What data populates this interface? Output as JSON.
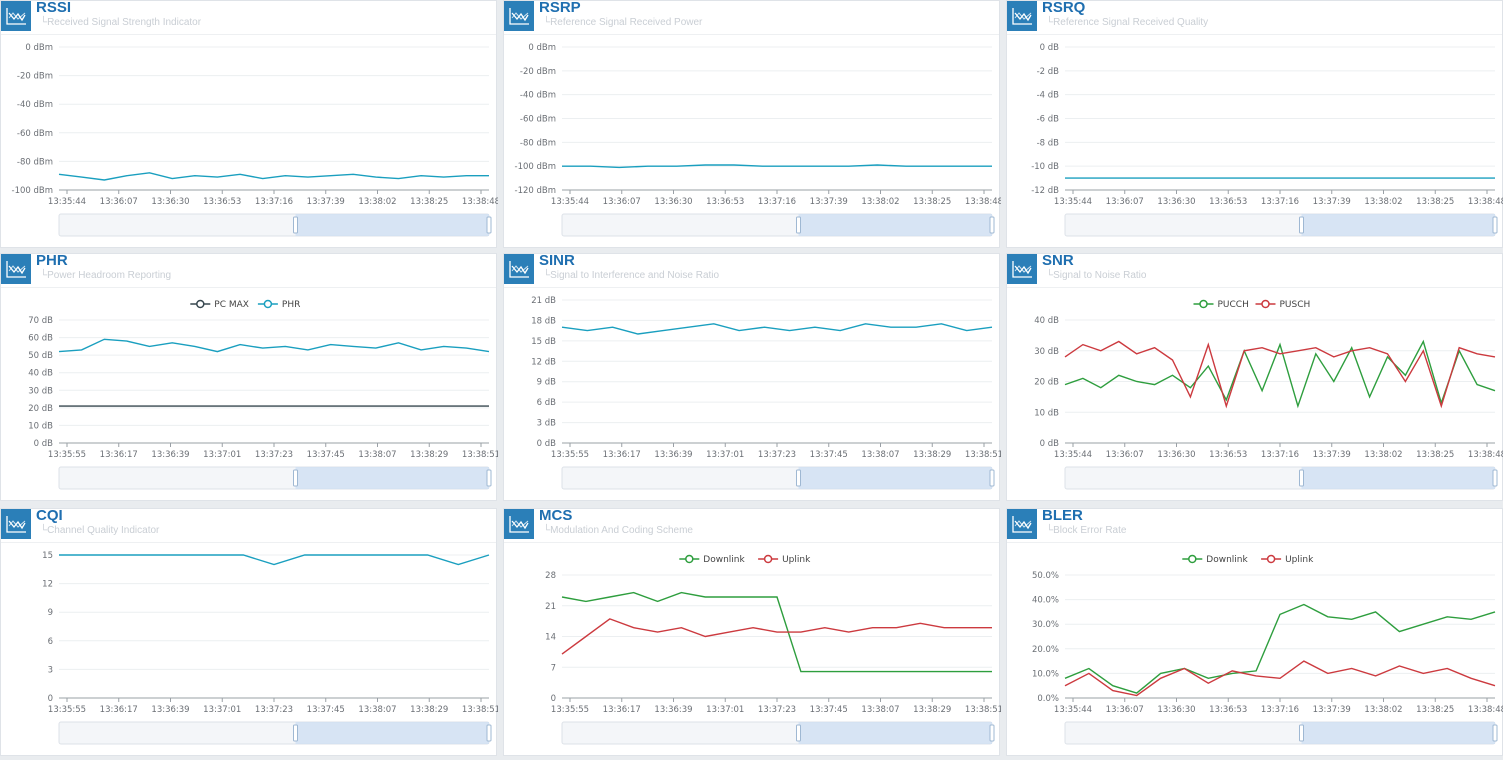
{
  "panels": [
    {
      "id": "rssi",
      "title": "RSSI",
      "subtitle": "└Received Signal Strength Indicator"
    },
    {
      "id": "rsrp",
      "title": "RSRP",
      "subtitle": "└Reference Signal Received Power"
    },
    {
      "id": "rsrq",
      "title": "RSRQ",
      "subtitle": "└Reference Signal Received Quality"
    },
    {
      "id": "phr",
      "title": "PHR",
      "subtitle": "└Power Headroom Reporting"
    },
    {
      "id": "sinr",
      "title": "SINR",
      "subtitle": "└Signal to Interference and Noise Ratio"
    },
    {
      "id": "snr",
      "title": "SNR",
      "subtitle": "└Signal to Noise Ratio"
    },
    {
      "id": "cqi",
      "title": "CQI",
      "subtitle": "└Channel Quality Indicator"
    },
    {
      "id": "mcs",
      "title": "MCS",
      "subtitle": "└Modulation And Coding Scheme"
    },
    {
      "id": "bler",
      "title": "BLER",
      "subtitle": "└Block Error Rate"
    }
  ],
  "chart_data": [
    {
      "id": "rssi",
      "type": "line",
      "yticks": [
        "0 dBm",
        "-20 dBm",
        "-40 dBm",
        "-60 dBm",
        "-80 dBm",
        "-100 dBm"
      ],
      "ylim": [
        -100,
        0
      ],
      "x": [
        "13:35:44",
        "13:36:07",
        "13:36:30",
        "13:36:53",
        "13:37:16",
        "13:37:39",
        "13:38:02",
        "13:38:25",
        "13:38:48"
      ],
      "series": [
        {
          "color": "#1a9fbf",
          "y": [
            -89,
            -91,
            -93,
            -90,
            -88,
            -92,
            -90,
            -91,
            -89,
            -92,
            -90,
            -91,
            -90,
            -89,
            -91,
            -92,
            -90,
            -91,
            -90,
            -90
          ]
        }
      ]
    },
    {
      "id": "rsrp",
      "type": "line",
      "yticks": [
        "0 dBm",
        "-20 dBm",
        "-40 dBm",
        "-60 dBm",
        "-80 dBm",
        "-100 dBm",
        "-120 dBm"
      ],
      "ylim": [
        -120,
        0
      ],
      "x": [
        "13:35:44",
        "13:36:07",
        "13:36:30",
        "13:36:53",
        "13:37:16",
        "13:37:39",
        "13:38:02",
        "13:38:25",
        "13:38:48"
      ],
      "series": [
        {
          "color": "#1a9fbf",
          "y": [
            -100,
            -100,
            -101,
            -100,
            -100,
            -99,
            -99,
            -100,
            -100,
            -100,
            -100,
            -99,
            -100,
            -100,
            -100,
            -100
          ]
        }
      ]
    },
    {
      "id": "rsrq",
      "type": "line",
      "yticks": [
        "0 dB",
        "-2 dB",
        "-4 dB",
        "-6 dB",
        "-8 dB",
        "-10 dB",
        "-12 dB"
      ],
      "ylim": [
        -12,
        0
      ],
      "x": [
        "13:35:44",
        "13:36:07",
        "13:36:30",
        "13:36:53",
        "13:37:16",
        "13:37:39",
        "13:38:02",
        "13:38:25",
        "13:38:48"
      ],
      "series": [
        {
          "color": "#1a9fbf",
          "y": [
            -11,
            -11,
            -11,
            -11,
            -11,
            -11,
            -11,
            -11
          ]
        }
      ]
    },
    {
      "id": "phr",
      "type": "line",
      "yticks": [
        "70 dB",
        "60 dB",
        "50 dB",
        "40 dB",
        "30 dB",
        "20 dB",
        "10 dB",
        "0 dB"
      ],
      "ylim": [
        0,
        70
      ],
      "x": [
        "13:35:55",
        "13:36:17",
        "13:36:39",
        "13:37:01",
        "13:37:23",
        "13:37:45",
        "13:38:07",
        "13:38:29",
        "13:38:51"
      ],
      "legend": [
        "PC MAX",
        "PHR"
      ],
      "series": [
        {
          "name": "PC MAX",
          "color": "#37474f",
          "y": [
            21,
            21,
            21,
            21,
            21,
            21
          ]
        },
        {
          "name": "PHR",
          "color": "#1a9fbf",
          "y": [
            52,
            53,
            59,
            58,
            55,
            57,
            55,
            52,
            56,
            54,
            55,
            53,
            56,
            55,
            54,
            57,
            53,
            55,
            54,
            52
          ]
        }
      ]
    },
    {
      "id": "sinr",
      "type": "line",
      "yticks": [
        "21 dB",
        "18 dB",
        "15 dB",
        "12 dB",
        "9 dB",
        "6 dB",
        "3 dB",
        "0 dB"
      ],
      "ylim": [
        0,
        21
      ],
      "x": [
        "13:35:55",
        "13:36:17",
        "13:36:39",
        "13:37:01",
        "13:37:23",
        "13:37:45",
        "13:38:07",
        "13:38:29",
        "13:38:51"
      ],
      "series": [
        {
          "color": "#1a9fbf",
          "y": [
            17,
            16.5,
            17,
            16,
            16.5,
            17,
            17.5,
            16.5,
            17,
            16.5,
            17,
            16.5,
            17.5,
            17,
            17,
            17.5,
            16.5,
            17
          ]
        }
      ]
    },
    {
      "id": "snr",
      "type": "line",
      "yticks": [
        "40 dB",
        "30 dB",
        "20 dB",
        "10 dB",
        "0 dB"
      ],
      "ylim": [
        0,
        40
      ],
      "x": [
        "13:35:44",
        "13:36:07",
        "13:36:30",
        "13:36:53",
        "13:37:16",
        "13:37:39",
        "13:38:02",
        "13:38:25",
        "13:38:48"
      ],
      "legend": [
        "PUCCH",
        "PUSCH"
      ],
      "series": [
        {
          "name": "PUCCH",
          "color": "#2e9e3e",
          "y": [
            19,
            21,
            18,
            22,
            20,
            19,
            22,
            18,
            25,
            14,
            30,
            17,
            32,
            12,
            29,
            20,
            31,
            15,
            28,
            22,
            33,
            13,
            30,
            19,
            17
          ]
        },
        {
          "name": "PUSCH",
          "color": "#cc3a3f",
          "y": [
            28,
            32,
            30,
            33,
            29,
            31,
            27,
            15,
            32,
            12,
            30,
            31,
            29,
            30,
            31,
            28,
            30,
            31,
            29,
            20,
            30,
            12,
            31,
            29,
            28
          ]
        }
      ]
    },
    {
      "id": "cqi",
      "type": "line",
      "yticks": [
        "15",
        "12",
        "9",
        "6",
        "3",
        "0"
      ],
      "ylim": [
        0,
        15
      ],
      "x": [
        "13:35:55",
        "13:36:17",
        "13:36:39",
        "13:37:01",
        "13:37:23",
        "13:37:45",
        "13:38:07",
        "13:38:29",
        "13:38:51"
      ],
      "series": [
        {
          "color": "#1a9fbf",
          "y": [
            15,
            15,
            15,
            15,
            15,
            15,
            15,
            14,
            15,
            15,
            15,
            15,
            15,
            14,
            15
          ]
        }
      ]
    },
    {
      "id": "mcs",
      "type": "line",
      "yticks": [
        "28",
        "21",
        "14",
        "7",
        "0"
      ],
      "ylim": [
        0,
        28
      ],
      "x": [
        "13:35:55",
        "13:36:17",
        "13:36:39",
        "13:37:01",
        "13:37:23",
        "13:37:45",
        "13:38:07",
        "13:38:29",
        "13:38:51"
      ],
      "legend": [
        "Downlink",
        "Uplink"
      ],
      "series": [
        {
          "name": "Downlink",
          "color": "#2e9e3e",
          "y": [
            23,
            22,
            23,
            24,
            22,
            24,
            23,
            23,
            23,
            23,
            6,
            6,
            6,
            6,
            6,
            6,
            6,
            6,
            6
          ]
        },
        {
          "name": "Uplink",
          "color": "#cc3a3f",
          "y": [
            10,
            14,
            18,
            16,
            15,
            16,
            14,
            15,
            16,
            15,
            15,
            16,
            15,
            16,
            16,
            17,
            16,
            16,
            16
          ]
        }
      ]
    },
    {
      "id": "bler",
      "type": "line",
      "yticks": [
        "50.0%",
        "40.0%",
        "30.0%",
        "20.0%",
        "10.0%",
        "0.0%"
      ],
      "ylim": [
        0,
        50
      ],
      "x": [
        "13:35:44",
        "13:36:07",
        "13:36:30",
        "13:36:53",
        "13:37:16",
        "13:37:39",
        "13:38:02",
        "13:38:25",
        "13:38:48"
      ],
      "legend": [
        "Downlink",
        "Uplink"
      ],
      "series": [
        {
          "name": "Downlink",
          "color": "#2e9e3e",
          "y": [
            8,
            12,
            5,
            2,
            10,
            12,
            8,
            10,
            11,
            34,
            38,
            33,
            32,
            35,
            27,
            30,
            33,
            32,
            35
          ]
        },
        {
          "name": "Uplink",
          "color": "#cc3a3f",
          "y": [
            5,
            10,
            3,
            1,
            8,
            12,
            6,
            11,
            9,
            8,
            15,
            10,
            12,
            9,
            13,
            10,
            12,
            8,
            5
          ]
        }
      ]
    }
  ]
}
